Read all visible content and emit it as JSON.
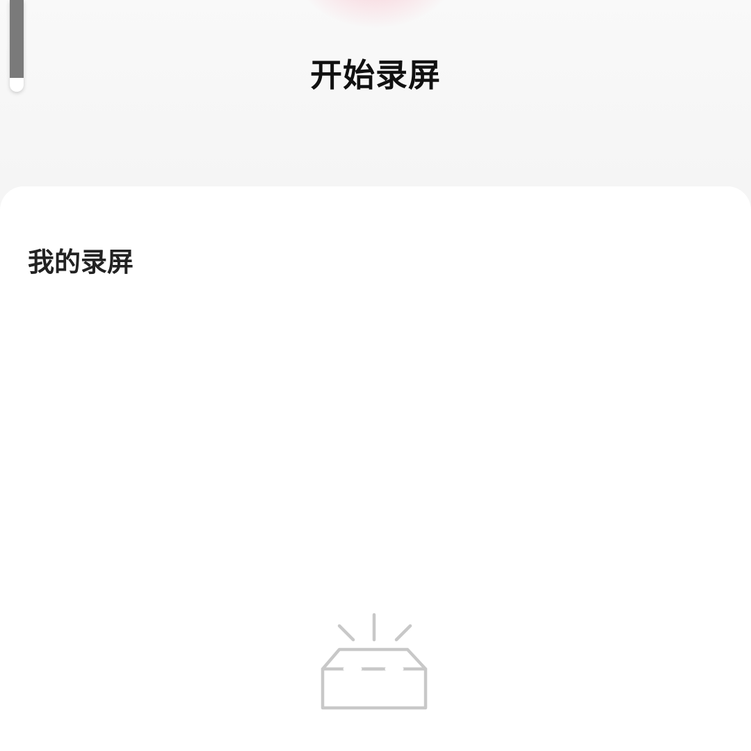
{
  "header": {
    "start_record_label": "开始录屏"
  },
  "recordings": {
    "heading": "我的录屏",
    "items": []
  },
  "icons": {
    "record_button": "record-button-icon",
    "empty_state": "empty-box-icon"
  },
  "colors": {
    "record_glow": "#f596aa",
    "empty_icon_stroke": "#c8c8c8",
    "title_text": "#111111",
    "heading_text": "#222222"
  }
}
